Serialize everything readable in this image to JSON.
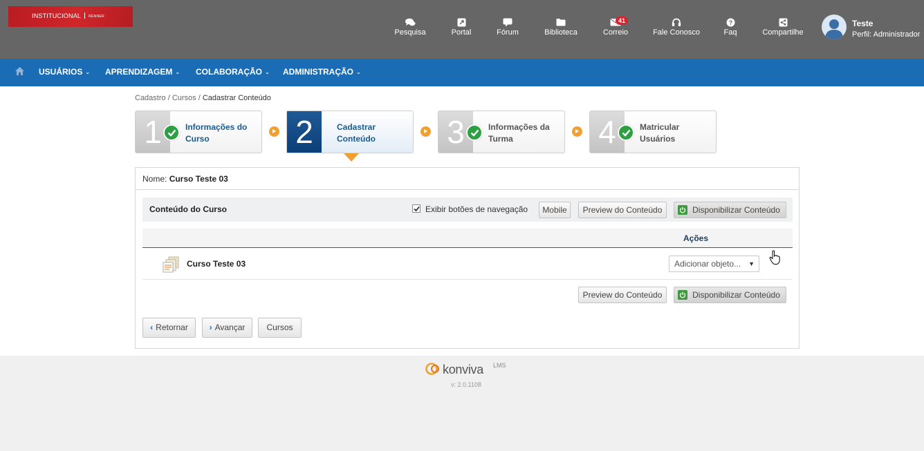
{
  "header": {
    "logo": {
      "text": "INSTITUCIONAL",
      "sub": "RENNER"
    },
    "nav": [
      {
        "label": "Pesquisa",
        "icon": "chat-bubbles-icon"
      },
      {
        "label": "Portal",
        "icon": "external-link-icon"
      },
      {
        "label": "Fórum",
        "icon": "comment-icon"
      },
      {
        "label": "Biblioteca",
        "icon": "folder-icon"
      },
      {
        "label": "Correio",
        "icon": "envelope-icon",
        "badge": "41"
      },
      {
        "label": "Fale Conosco",
        "icon": "headset-icon"
      },
      {
        "label": "Faq",
        "icon": "question-icon"
      },
      {
        "label": "Compartilhe",
        "icon": "share-icon"
      }
    ],
    "user": {
      "name": "Teste",
      "role": "Perfil: Administrador"
    }
  },
  "main_nav": {
    "items": [
      {
        "label": "USUÁRIOS"
      },
      {
        "label": "APRENDIZAGEM"
      },
      {
        "label": "COLABORAÇÃO"
      },
      {
        "label": "ADMINISTRAÇÃO"
      }
    ]
  },
  "breadcrumb": {
    "items": [
      "Cadastro",
      "Cursos"
    ],
    "separator": "/",
    "current": "Cadastrar Conteúdo"
  },
  "steps": [
    {
      "number": "1",
      "line1": "Informações do",
      "line2": "Curso",
      "status": "done"
    },
    {
      "number": "2",
      "line1": "Cadastrar",
      "line2": "Conteúdo",
      "status": "active"
    },
    {
      "number": "3",
      "line1": "Informações da",
      "line2": "Turma",
      "status": "done"
    },
    {
      "number": "4",
      "line1": "Matricular",
      "line2": "Usuários",
      "status": "done"
    }
  ],
  "course_name": {
    "label": "Nome:",
    "value": "Curso Teste 03"
  },
  "panel": {
    "title": "Conteúdo do Curso",
    "show_nav_label": "Exibir botões de navegação",
    "show_nav_checked": true,
    "mobile_label": "Mobile",
    "preview_label": "Preview do Conteúdo",
    "publish_label": "Disponibilizar Conteúdo",
    "actions_header": "Ações",
    "rows": [
      {
        "title": "Curso Teste 03",
        "select_value": "Adicionar objeto..."
      }
    ]
  },
  "footer_buttons": {
    "back": "Retornar",
    "next": "Avançar",
    "courses": "Cursos"
  },
  "footer": {
    "brand": "konviva",
    "suffix": "LMS",
    "version": "v: 2.0.1108"
  },
  "colors": {
    "header": "#666666",
    "nav": "#1a6db5",
    "accent": "#f0a030",
    "active_step": "#0b3f78",
    "check": "#2ea043"
  }
}
